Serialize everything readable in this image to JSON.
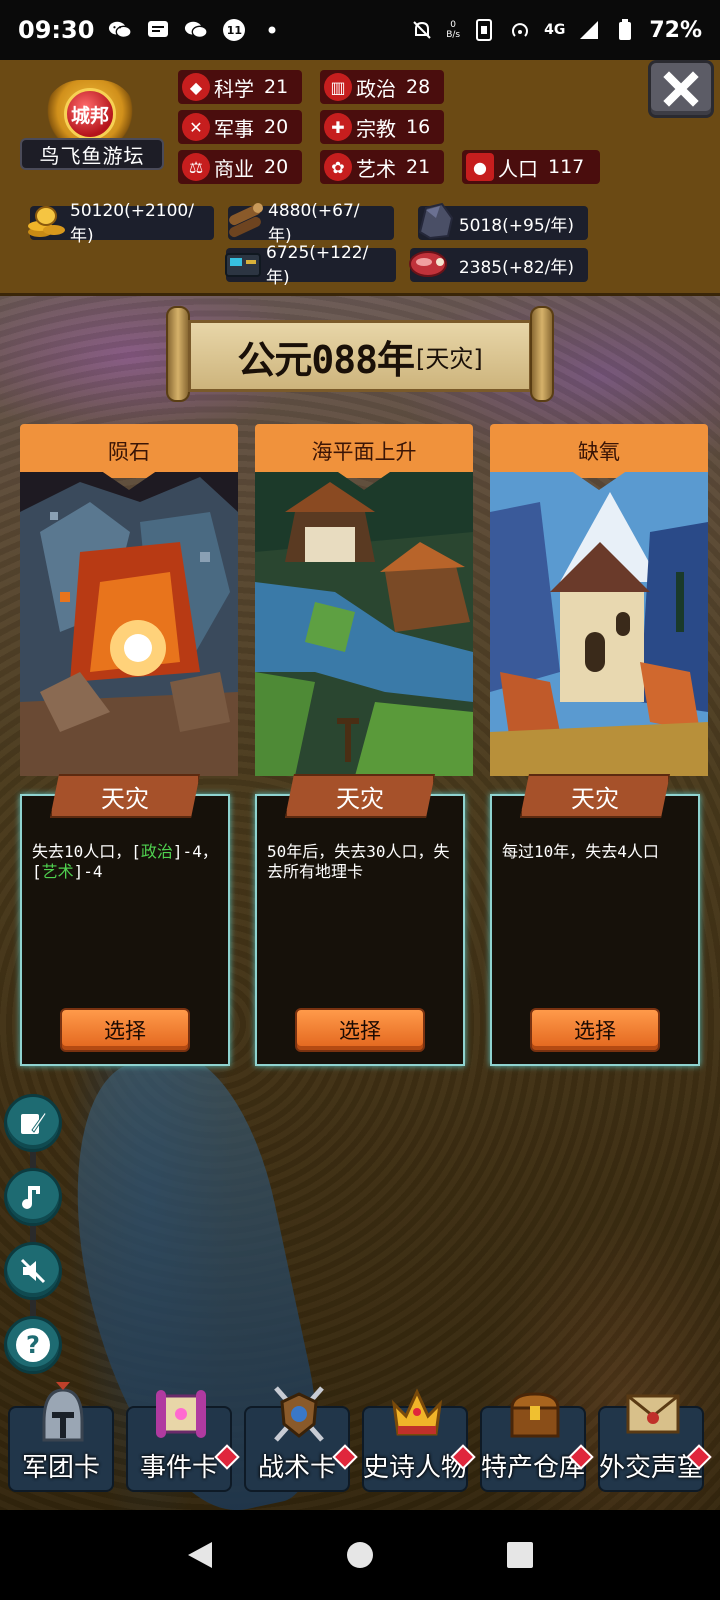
{
  "status_bar": {
    "time": "09:30",
    "notification_badge": "11",
    "network_speed_value": "0",
    "network_speed_unit": "B/s",
    "network_type": "4G",
    "battery": "72%"
  },
  "city": {
    "emblem_label": "城邦",
    "name": "鸟飞鱼游坛"
  },
  "stats": [
    {
      "label": "科学",
      "value": "21",
      "icon": "science-icon",
      "glyph": "◆"
    },
    {
      "label": "政治",
      "value": "28",
      "icon": "politics-icon",
      "glyph": "▥"
    },
    {
      "label": "军事",
      "value": "20",
      "icon": "military-icon",
      "glyph": "✕"
    },
    {
      "label": "宗教",
      "value": "16",
      "icon": "religion-icon",
      "glyph": "✚"
    },
    {
      "label": "商业",
      "value": "20",
      "icon": "commerce-icon",
      "glyph": "⚖"
    },
    {
      "label": "艺术",
      "value": "21",
      "icon": "art-icon",
      "glyph": "✿"
    },
    {
      "label": "人口",
      "value": "117",
      "icon": "population-icon",
      "glyph": "●"
    }
  ],
  "resources": [
    {
      "name": "gold",
      "text": "50120(+2100/年)",
      "icon": "gold-coins-icon"
    },
    {
      "name": "wood",
      "text": "4880(+67/年)",
      "icon": "wood-logs-icon"
    },
    {
      "name": "stone",
      "text": "5018(+95/年)",
      "icon": "stone-icon"
    },
    {
      "name": "tech",
      "text": "6725(+122/年)",
      "icon": "machine-icon"
    },
    {
      "name": "meat",
      "text": "2385(+82/年)",
      "icon": "meat-icon"
    }
  ],
  "banner": {
    "year": "公元088年",
    "tag": "[天灾]"
  },
  "cards": [
    {
      "title": "陨石",
      "type": "天灾",
      "desc_parts": [
        "失去10人口，[",
        "政治",
        "]-4，[",
        "艺术",
        "]-4"
      ],
      "button": "选择"
    },
    {
      "title": "海平面上升",
      "type": "天灾",
      "desc": "50年后，失去30人口，失去所有地理卡",
      "button": "选择"
    },
    {
      "title": "缺氧",
      "type": "天灾",
      "desc": "每过10年，失去4人口",
      "button": "选择"
    }
  ],
  "side_buttons": [
    {
      "name": "journal-button",
      "icon": "book-quill-icon"
    },
    {
      "name": "music-button",
      "icon": "music-note-icon"
    },
    {
      "name": "sound-mute-button",
      "icon": "speaker-muted-icon"
    },
    {
      "name": "help-button",
      "icon": "question-icon"
    }
  ],
  "dock": [
    {
      "label": "军团卡",
      "icon": "helmet-icon",
      "has_dot": false
    },
    {
      "label": "事件卡",
      "icon": "scroll-icon",
      "has_dot": true
    },
    {
      "label": "战术卡",
      "icon": "shield-swords-icon",
      "has_dot": true
    },
    {
      "label": "史诗人物",
      "icon": "crown-icon",
      "has_dot": true
    },
    {
      "label": "特产仓库",
      "icon": "treasure-chest-icon",
      "has_dot": true
    },
    {
      "label": "外交声望",
      "icon": "envelope-icon",
      "has_dot": true
    }
  ],
  "colors": {
    "card_title_bg": "#f0923c",
    "ribbon": "#a6512a",
    "select_button": "#f07a30",
    "desc_border": "#8fd3d0",
    "green_text": "#4fd14f",
    "stat_icon_red": "#c61e1e",
    "header_bg": "#6b4a14"
  }
}
